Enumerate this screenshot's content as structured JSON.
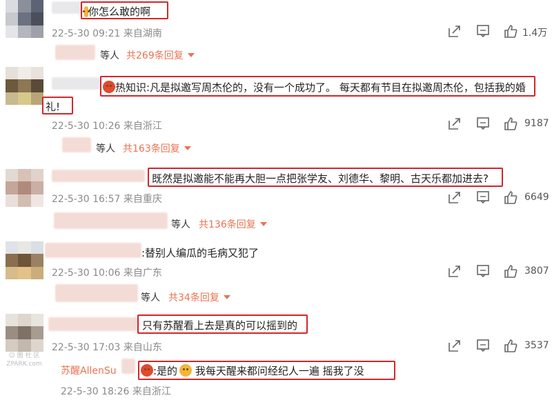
{
  "comments": [
    {
      "text": "你怎么敢的啊",
      "date": "22-5-30 09:21",
      "location": "来自湖南",
      "likes": "1.4万",
      "reply_others": "等人",
      "reply_count": "共269条回复"
    },
    {
      "text_line1": "热知识:凡是拟邀写周杰伦的，没有一个成功了。 每天都有节目在拟邀周杰伦，包括我的婚",
      "text_line2": "礼!",
      "date": "22-5-30 10:26",
      "location": "来自浙江",
      "likes": "9187",
      "reply_others": "等人",
      "reply_count": "共163条回复"
    },
    {
      "text": "既然是拟邀能不能再大胆一点把张学友、刘德华、黎明、古天乐都加进去?",
      "date": "22-5-30 16:57",
      "location": "来自重庆",
      "likes": "6649",
      "reply_others": "等人",
      "reply_count": "共136条回复"
    },
    {
      "text": ":替别人编瓜的毛病又犯了",
      "date": "22-5-30 10:06",
      "location": "来自广东",
      "likes": "3807",
      "reply_others": "等人",
      "reply_count": "共34条回复"
    },
    {
      "text": "只有苏醒看上去是真的可以摇到的",
      "date": "22-5-30 17:03",
      "location": "来自山东",
      "likes": "3537"
    }
  ],
  "reply": {
    "nickname": "苏醒AllenSu",
    "text_a": ":是的",
    "text_b": " 我每天醒来都问经纪人一遍 摇我了没",
    "date": "22-5-30 18:26",
    "location": "来自浙江"
  },
  "watermark": {
    "line1": "☺ 图 社 区",
    "line2": "ZPARK.com"
  },
  "icons": [
    "share-icon",
    "comment-icon",
    "like-icon"
  ],
  "colors": {
    "highlight_box": "#d2262a",
    "reply_link": "#eb7350",
    "meta": "#8a8a8a"
  }
}
